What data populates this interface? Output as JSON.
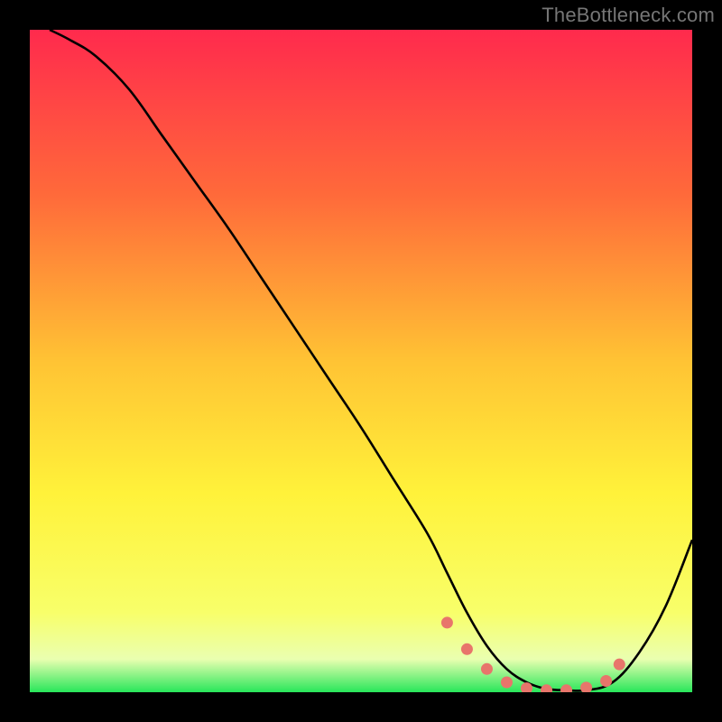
{
  "watermark": "TheBottleneck.com",
  "chart_data": {
    "type": "line",
    "title": "",
    "xlabel": "",
    "ylabel": "",
    "xlim": [
      0,
      100
    ],
    "ylim": [
      0,
      100
    ],
    "gradient_stops": [
      {
        "offset": 0.0,
        "color": "#ff2a4d"
      },
      {
        "offset": 0.25,
        "color": "#ff6a3a"
      },
      {
        "offset": 0.5,
        "color": "#ffc334"
      },
      {
        "offset": 0.7,
        "color": "#fff23a"
      },
      {
        "offset": 0.88,
        "color": "#f8ff6a"
      },
      {
        "offset": 0.95,
        "color": "#eaffb0"
      },
      {
        "offset": 1.0,
        "color": "#28e65a"
      }
    ],
    "series": [
      {
        "name": "bottleneck-curve",
        "x": [
          3,
          6,
          10,
          15,
          20,
          25,
          30,
          35,
          40,
          45,
          50,
          55,
          60,
          63,
          66,
          69,
          72,
          75,
          78,
          81,
          84,
          88,
          92,
          96,
          100
        ],
        "values": [
          100,
          98.5,
          96,
          91,
          84,
          77,
          70,
          62.5,
          55,
          47.5,
          40,
          32,
          24,
          18,
          12,
          7,
          3.5,
          1.5,
          0.5,
          0.3,
          0.3,
          1.5,
          6,
          13,
          23
        ]
      }
    ],
    "marker_curve": {
      "name": "bottleneck-markers",
      "color": "#e8756b",
      "x": [
        63,
        66,
        69,
        72,
        75,
        78,
        81,
        84,
        87,
        89
      ],
      "y": [
        10.5,
        6.5,
        3.5,
        1.5,
        0.6,
        0.3,
        0.3,
        0.7,
        1.7,
        4.2
      ]
    }
  }
}
